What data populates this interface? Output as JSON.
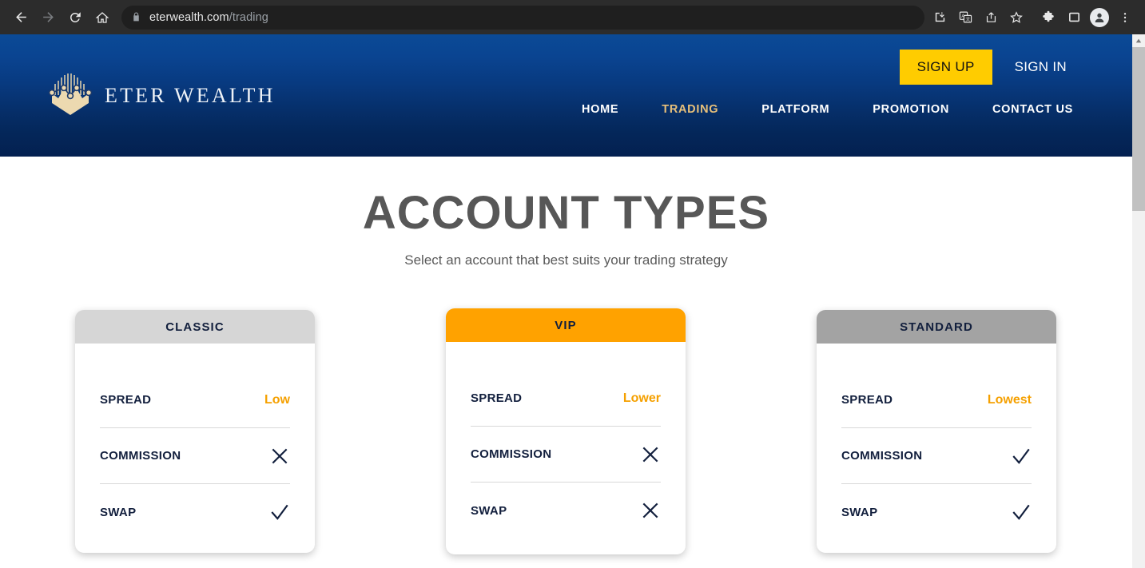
{
  "browser": {
    "url_domain": "eterwealth.com",
    "url_path": "/trading",
    "back_icon": "back-arrow-icon",
    "forward_icon": "forward-arrow-icon",
    "reload_icon": "reload-icon",
    "home_icon": "home-icon",
    "lock_icon": "lock-icon",
    "toolbar_icons": [
      "download-icon",
      "translate-icon",
      "share-icon",
      "bookmark-star-icon",
      "extensions-puzzle-icon",
      "side-panel-icon",
      "profile-avatar-icon",
      "more-menu-icon"
    ]
  },
  "header": {
    "logo_text": "ETER WEALTH",
    "logo_icon": "crown-chart-logo-icon",
    "sign_up_label": "SIGN UP",
    "sign_in_label": "SIGN IN",
    "nav": [
      {
        "label": "HOME",
        "active": false
      },
      {
        "label": "TRADING",
        "active": true
      },
      {
        "label": "PLATFORM",
        "active": false
      },
      {
        "label": "PROMOTION",
        "active": false
      },
      {
        "label": "CONTACT US",
        "active": false
      }
    ],
    "colors": {
      "gradient_top": "#0b4a96",
      "gradient_bottom": "#032050",
      "signup_bg": "#ffcc00",
      "nav_active": "#e8c07a"
    }
  },
  "main": {
    "title": "ACCOUNT TYPES",
    "subtitle": "Select an account that best suits your trading strategy",
    "cards": [
      {
        "name": "CLASSIC",
        "header_color": "#d6d6d6",
        "rows": [
          {
            "label": "SPREAD",
            "value": "Low",
            "type": "text"
          },
          {
            "label": "COMMISSION",
            "value": "cross-icon",
            "type": "icon"
          },
          {
            "label": "SWAP",
            "value": "check-icon",
            "type": "icon"
          }
        ]
      },
      {
        "name": "VIP",
        "header_color": "#ffa200",
        "rows": [
          {
            "label": "SPREAD",
            "value": "Lower",
            "type": "text"
          },
          {
            "label": "COMMISSION",
            "value": "cross-icon",
            "type": "icon"
          },
          {
            "label": "SWAP",
            "value": "cross-icon",
            "type": "icon"
          }
        ]
      },
      {
        "name": "STANDARD",
        "header_color": "#a3a3a3",
        "rows": [
          {
            "label": "SPREAD",
            "value": "Lowest",
            "type": "text"
          },
          {
            "label": "COMMISSION",
            "value": "check-icon",
            "type": "icon"
          },
          {
            "label": "SWAP",
            "value": "check-icon",
            "type": "icon"
          }
        ]
      }
    ],
    "value_color": "#f5a000"
  }
}
